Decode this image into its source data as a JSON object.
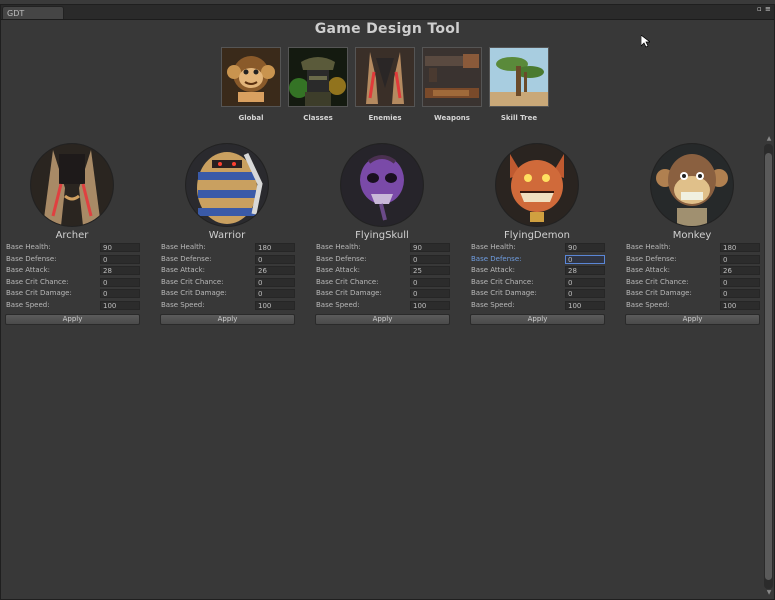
{
  "window": {
    "tab_label": "GDT",
    "title": "Game Design Tool"
  },
  "nav": [
    {
      "label": "Global",
      "icon": "monkey-icon"
    },
    {
      "label": "Classes",
      "icon": "soldier-icon"
    },
    {
      "label": "Enemies",
      "icon": "demon-icon"
    },
    {
      "label": "Weapons",
      "icon": "gun-icon"
    },
    {
      "label": "Skill Tree",
      "icon": "tree-icon"
    }
  ],
  "stat_labels": [
    "Base Health:",
    "Base Defense:",
    "Base Attack:",
    "Base Crit Chance:",
    "Base Crit Damage:",
    "Base Speed:"
  ],
  "apply_label": "Apply",
  "characters": [
    {
      "name": "Archer",
      "values": [
        "90",
        "0",
        "28",
        "0",
        "0",
        "100"
      ]
    },
    {
      "name": "Warrior",
      "values": [
        "180",
        "0",
        "26",
        "0",
        "0",
        "100"
      ]
    },
    {
      "name": "FlyingSkull",
      "values": [
        "90",
        "0",
        "25",
        "0",
        "0",
        "100"
      ]
    },
    {
      "name": "FlyingDemon",
      "values": [
        "90",
        "0",
        "28",
        "0",
        "0",
        "100"
      ]
    },
    {
      "name": "Monkey",
      "values": [
        "180",
        "0",
        "26",
        "0",
        "0",
        "100"
      ]
    }
  ],
  "colors": {
    "background": "#383838",
    "accent": "#5a86d6"
  }
}
